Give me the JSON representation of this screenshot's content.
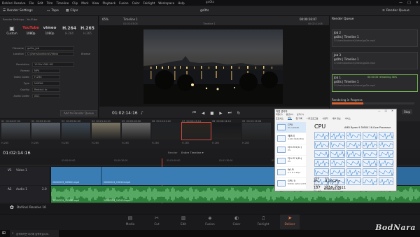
{
  "window": {
    "title": "gs0ts",
    "min": "—",
    "max": "□",
    "close": "✕"
  },
  "menu": [
    "DaVinci Resolve",
    "File",
    "Edit",
    "Trim",
    "Timeline",
    "Clip",
    "Mark",
    "View",
    "Playback",
    "Fusion",
    "Color",
    "Fairlight",
    "Workspace",
    "Help"
  ],
  "toolbar": {
    "render_settings": "Render Settings",
    "tape": "Tape",
    "clips": "Clips",
    "project": "gs0ts",
    "render_queue": "Render Queue"
  },
  "render_settings": {
    "title": "Render Settings - YouTube",
    "presets": [
      {
        "logo": "",
        "label": "Custom"
      },
      {
        "logo": "YouTube",
        "label": "1080p"
      },
      {
        "logo": "vimeo",
        "label": "1080p"
      },
      {
        "logo": "H.264",
        "label": "H.264"
      },
      {
        "logo": "H.265",
        "label": "H.265"
      }
    ],
    "filename_label": "Filename",
    "filename": "gs0ts_job",
    "location_label": "Location",
    "location": "C:\\Users\\bodnara\\Videos",
    "browse": "Browse",
    "fields": [
      {
        "label": "Resolution",
        "value": "1920x1080 HD"
      },
      {
        "label": "Format",
        "value": "MP4"
      },
      {
        "label": "Video Codec",
        "value": "H.264"
      },
      {
        "label": "Type",
        "value": "NVIDIA"
      },
      {
        "label": "Quality",
        "value": "Restrict to"
      },
      {
        "label": "Audio Codec",
        "value": "AAC"
      }
    ],
    "add_button": "Add to Render Queue"
  },
  "viewer": {
    "zoom": "65%",
    "source": "Timeline 1",
    "timecode_in": "01:02:03:05",
    "timecode_out": "00:00:16:07",
    "end_tc": "00:02:21:06",
    "playhead": "01:02:14:16",
    "mode": "Timeline ▾"
  },
  "clips": [
    {
      "num": "01",
      "tc": "00:04:07:00",
      "fmt": "H.265"
    },
    {
      "num": "02",
      "tc": "00:03:13:00",
      "fmt": "H.265"
    },
    {
      "num": "03",
      "tc": "00:05:54:00",
      "fmt": "H.265"
    },
    {
      "num": "04",
      "tc": "00:21:14:21",
      "fmt": "H.265"
    },
    {
      "num": "05",
      "tc": "00:05:16:00",
      "fmt": "H.265"
    },
    {
      "num": "06",
      "tc": "00:12:41:22",
      "fmt": "H.265"
    },
    {
      "num": "07",
      "tc": "00:00:13:14",
      "fmt": "H.265"
    },
    {
      "num": "08",
      "tc": "00:06:14:10",
      "fmt": "H.265"
    },
    {
      "num": "09",
      "tc": "00:03:13:08",
      "fmt": "H.265"
    }
  ],
  "timeline": {
    "timecode": "01:02:14:16",
    "render_label": "Render",
    "render_value": "Entire Timeline ▾",
    "ruler": [
      "01:00:00:00",
      "01:00:30:00",
      "01:01:00:00",
      "01:01:30:00",
      "01:02:00:00",
      "01:02:30:00",
      "01:03:00:00"
    ],
    "v1": {
      "name": "Video 1",
      "badge": "V1",
      "clips": [
        "20200229_185641.mp4",
        "20200224_192424.mp4"
      ]
    },
    "a1": {
      "name": "Audio 1",
      "badge": "A1",
      "value": "2.0",
      "clips": [
        "20200229_185641.mp4",
        "20200224_192424.mp4"
      ]
    }
  },
  "queue": {
    "title": "Render Queue",
    "jobs": [
      {
        "id": "Job 2",
        "name": "gs0ts | Timeline 1",
        "path": "C:\\Users\\bodnara\\Videos\\gs0ts.mp4",
        "status": ""
      },
      {
        "id": "Job 3",
        "name": "gs0ts | Timeline 1",
        "path": "C:\\Users\\bodnara\\Videos\\gs0ts.mp4",
        "status": ""
      },
      {
        "id": "Job 1",
        "name": "gs0ts | Timeline 1",
        "path": "C:\\Users\\bodnara\\Videos\\gs0ts.mp4",
        "status": "00:00:35 remaining 38%"
      }
    ],
    "progress_label": "Rendering in Progress",
    "progress_pct": 38,
    "stop": "Stop"
  },
  "pages": [
    "Media",
    "Cut",
    "Edit",
    "Fusion",
    "Color",
    "Fairlight",
    "Deliver"
  ],
  "active_page": "Deliver",
  "app_name": "DaVinci Resolve 16",
  "taskmgr": {
    "title": "작업 관리자",
    "menu": [
      "파일(F)",
      "옵션(O)",
      "보기(V)"
    ],
    "tabs": [
      "프로세스",
      "성능",
      "앱 기록",
      "시작프로그램",
      "사용자",
      "세부 정보",
      "서비스"
    ],
    "items": [
      {
        "name": "CPU",
        "sub": "4% 4.20GHz"
      },
      {
        "name": "메모리",
        "sub": "4.1/15.9GB (26%)"
      },
      {
        "name": "디스크 0(C:)",
        "sub": "0%"
      },
      {
        "name": "디스크 1(D:)",
        "sub": "0%"
      },
      {
        "name": "Wi-Fi",
        "sub": "S: 0 R: 0 Kbps"
      },
      {
        "name": "GPU 0",
        "sub": "NVIDIA GeForce RTX 3% (45°C)"
      }
    ],
    "heading": "CPU",
    "model": "AMD Ryzen 9 3950X 16-Core Processor",
    "util_label": "사용률",
    "util": "4%",
    "speed_label": "속도",
    "speed": "4.20GHz",
    "proc_label": "프로세스",
    "proc": "187",
    "thread_label": "스레드",
    "thread": "2658",
    "handle_label": "핸들",
    "handle": "77611",
    "uptime_label": "작동 시간",
    "uptime": "0:00:35:32"
  },
  "taskbar_search": "검색하려면 여기에 입력하십시오.",
  "watermark": "BodNara"
}
